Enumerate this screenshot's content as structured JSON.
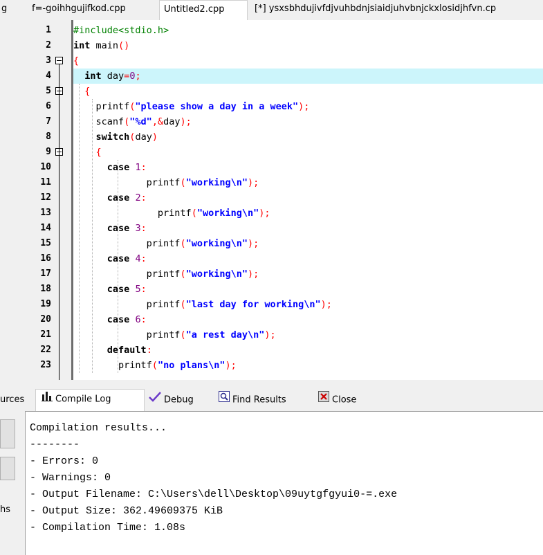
{
  "tabs": [
    {
      "label": "g"
    },
    {
      "label": "f=-goihhgujifkod.cpp"
    },
    {
      "label": "Untitled2.cpp",
      "active": true
    },
    {
      "label": "[*] ysxsbhdujivfdjvuhbdnjsiaidjuhvbnjckxlosidjhfvn.cp"
    }
  ],
  "editor": {
    "highlight_line": 4,
    "lines": [
      {
        "n": "1",
        "segs": [
          [
            "pp",
            "#include<stdio.h>"
          ]
        ]
      },
      {
        "n": "2",
        "segs": [
          [
            "kw",
            "int"
          ],
          [
            "nm",
            " main"
          ],
          [
            "br",
            "()"
          ]
        ]
      },
      {
        "n": "3",
        "segs": [
          [
            "br",
            "{"
          ]
        ]
      },
      {
        "n": "4",
        "segs": [
          [
            "nm",
            "  "
          ],
          [
            "kw",
            "int"
          ],
          [
            "nm",
            " day"
          ],
          [
            "op",
            "="
          ],
          [
            "num",
            "0"
          ],
          [
            "op",
            ";"
          ]
        ]
      },
      {
        "n": "5",
        "segs": [
          [
            "nm",
            "  "
          ],
          [
            "br",
            "{"
          ]
        ]
      },
      {
        "n": "6",
        "segs": [
          [
            "nm",
            "    printf"
          ],
          [
            "br",
            "("
          ],
          [
            "str",
            "\"please show a day in a week\""
          ],
          [
            "br",
            ")"
          ],
          [
            "op",
            ";"
          ]
        ]
      },
      {
        "n": "7",
        "segs": [
          [
            "nm",
            "    scanf"
          ],
          [
            "br",
            "("
          ],
          [
            "str",
            "\"%d\""
          ],
          [
            "op",
            ",&"
          ],
          [
            "nm",
            "day"
          ],
          [
            "br",
            ")"
          ],
          [
            "op",
            ";"
          ]
        ]
      },
      {
        "n": "8",
        "segs": [
          [
            "nm",
            "    "
          ],
          [
            "kw",
            "switch"
          ],
          [
            "br",
            "("
          ],
          [
            "nm",
            "day"
          ],
          [
            "br",
            ")"
          ]
        ]
      },
      {
        "n": "9",
        "segs": [
          [
            "nm",
            "    "
          ],
          [
            "br",
            "{"
          ]
        ]
      },
      {
        "n": "10",
        "segs": [
          [
            "nm",
            "      "
          ],
          [
            "kw",
            "case"
          ],
          [
            "nm",
            " "
          ],
          [
            "num",
            "1"
          ],
          [
            "op",
            ":"
          ]
        ]
      },
      {
        "n": "11",
        "segs": [
          [
            "nm",
            "             printf"
          ],
          [
            "br",
            "("
          ],
          [
            "str",
            "\"working\\n\""
          ],
          [
            "br",
            ")"
          ],
          [
            "op",
            ";"
          ]
        ]
      },
      {
        "n": "12",
        "segs": [
          [
            "nm",
            "      "
          ],
          [
            "kw",
            "case"
          ],
          [
            "nm",
            " "
          ],
          [
            "num",
            "2"
          ],
          [
            "op",
            ":"
          ]
        ]
      },
      {
        "n": "13",
        "segs": [
          [
            "nm",
            "               printf"
          ],
          [
            "br",
            "("
          ],
          [
            "str",
            "\"working\\n\""
          ],
          [
            "br",
            ")"
          ],
          [
            "op",
            ";"
          ]
        ]
      },
      {
        "n": "14",
        "segs": [
          [
            "nm",
            "      "
          ],
          [
            "kw",
            "case"
          ],
          [
            "nm",
            " "
          ],
          [
            "num",
            "3"
          ],
          [
            "op",
            ":"
          ]
        ]
      },
      {
        "n": "15",
        "segs": [
          [
            "nm",
            "             printf"
          ],
          [
            "br",
            "("
          ],
          [
            "str",
            "\"working\\n\""
          ],
          [
            "br",
            ")"
          ],
          [
            "op",
            ";"
          ]
        ]
      },
      {
        "n": "16",
        "segs": [
          [
            "nm",
            "      "
          ],
          [
            "kw",
            "case"
          ],
          [
            "nm",
            " "
          ],
          [
            "num",
            "4"
          ],
          [
            "op",
            ":"
          ]
        ]
      },
      {
        "n": "17",
        "segs": [
          [
            "nm",
            "             printf"
          ],
          [
            "br",
            "("
          ],
          [
            "str",
            "\"working\\n\""
          ],
          [
            "br",
            ")"
          ],
          [
            "op",
            ";"
          ]
        ]
      },
      {
        "n": "18",
        "segs": [
          [
            "nm",
            "      "
          ],
          [
            "kw",
            "case"
          ],
          [
            "nm",
            " "
          ],
          [
            "num",
            "5"
          ],
          [
            "op",
            ":"
          ]
        ]
      },
      {
        "n": "19",
        "segs": [
          [
            "nm",
            "             printf"
          ],
          [
            "br",
            "("
          ],
          [
            "str",
            "\"last day for working\\n\""
          ],
          [
            "br",
            ")"
          ],
          [
            "op",
            ";"
          ]
        ]
      },
      {
        "n": "20",
        "segs": [
          [
            "nm",
            "      "
          ],
          [
            "kw",
            "case"
          ],
          [
            "nm",
            " "
          ],
          [
            "num",
            "6"
          ],
          [
            "op",
            ":"
          ]
        ]
      },
      {
        "n": "21",
        "segs": [
          [
            "nm",
            "             printf"
          ],
          [
            "br",
            "("
          ],
          [
            "str",
            "\"a rest day\\n\""
          ],
          [
            "br",
            ")"
          ],
          [
            "op",
            ";"
          ]
        ]
      },
      {
        "n": "22",
        "segs": [
          [
            "nm",
            "      "
          ],
          [
            "kw",
            "default"
          ],
          [
            "op",
            ":"
          ]
        ]
      },
      {
        "n": "23",
        "segs": [
          [
            "nm",
            "        printf"
          ],
          [
            "br",
            "("
          ],
          [
            "str",
            "\"no plans\\n\""
          ],
          [
            "br",
            ")"
          ],
          [
            "op",
            ";"
          ]
        ]
      }
    ]
  },
  "panel_tabs": {
    "resources_label": "urces",
    "compile_log_label": "Compile Log",
    "debug_label": "Debug",
    "find_results_label": "Find Results",
    "close_label": "Close"
  },
  "side_label": "hs",
  "log": {
    "lines": [
      "Compilation results...",
      "--------",
      "- Errors: 0",
      "- Warnings: 0",
      "- Output Filename: C:\\Users\\dell\\Desktop\\09uytgfgyui0-=.exe",
      "- Output Size: 362.49609375 KiB",
      "- Compilation Time: 1.08s"
    ]
  }
}
